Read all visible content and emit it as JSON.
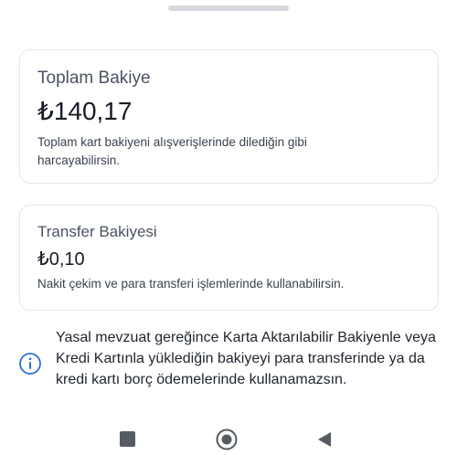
{
  "total_balance": {
    "title": "Toplam Bakiye",
    "amount": "₺140,17",
    "description": "Toplam kart bakiyeni alışverişlerinde dilediğin gibi harcayabilirsin."
  },
  "transfer_balance": {
    "title": "Transfer Bakiyesi",
    "amount": "₺0,10",
    "description": "Nakit çekim ve para transferi işlemlerinde kullanabilirsin."
  },
  "info_note": {
    "icon": "info-icon",
    "text": "Yasal mevzuat gereğince Karta Aktarılabilir Bakiyenle veya Kredi Kartınla yüklediğin bakiyeyi para transferinde ya da kredi kartı borç ödemelerinde kullanamazsın."
  },
  "system_nav": {
    "recents_icon": "square-icon",
    "home_icon": "home-circle-icon",
    "back_icon": "back-triangle-icon"
  },
  "colors": {
    "info_accent": "#2f6fd6",
    "nav_icon": "#555a63",
    "card_border": "#e4e6ea"
  }
}
